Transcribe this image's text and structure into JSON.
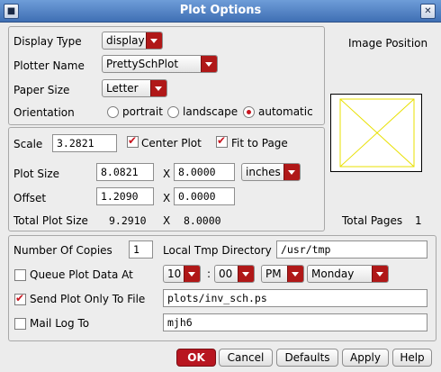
{
  "window": {
    "title": "Plot Options",
    "close_glyph": "✕"
  },
  "display_type": {
    "label": "Display Type",
    "value": "display"
  },
  "plotter_name": {
    "label": "Plotter Name",
    "value": "PrettySchPlot"
  },
  "paper_size": {
    "label": "Paper Size",
    "value": "Letter"
  },
  "orientation": {
    "label": "Orientation",
    "options": [
      "portrait",
      "landscape",
      "automatic"
    ],
    "selected": "automatic"
  },
  "image_position": {
    "label": "Image Position"
  },
  "scale": {
    "label": "Scale",
    "value": "3.2821"
  },
  "center_plot": {
    "label": "Center Plot",
    "checked": true
  },
  "fit_to_page": {
    "label": "Fit to Page",
    "checked": true
  },
  "plot_size": {
    "label": "Plot Size",
    "x": "8.0821",
    "sep": "X",
    "y": "8.0000",
    "units": "inches"
  },
  "offset": {
    "label": "Offset",
    "x": "1.2090",
    "sep": "X",
    "y": "0.0000"
  },
  "total_plot_size": {
    "label": "Total Plot Size",
    "x": "9.2910",
    "sep": "X",
    "y": "8.0000"
  },
  "total_pages": {
    "label": "Total Pages",
    "value": "1"
  },
  "copies": {
    "label": "Number Of Copies",
    "value": "1"
  },
  "tmp_dir": {
    "label": "Local Tmp Directory",
    "value": "/usr/tmp"
  },
  "queue": {
    "label": "Queue Plot Data At",
    "checked": false,
    "hour": "10",
    "colon": ":",
    "minute": "00",
    "ampm": "PM",
    "day": "Monday"
  },
  "send_to_file": {
    "label": "Send Plot Only To File",
    "checked": true,
    "value": "plots/inv_sch.ps"
  },
  "mail_log": {
    "label": "Mail Log To",
    "checked": false,
    "value": "mjh6"
  },
  "buttons": {
    "ok": "OK",
    "cancel": "Cancel",
    "defaults": "Defaults",
    "apply": "Apply",
    "help": "Help"
  }
}
